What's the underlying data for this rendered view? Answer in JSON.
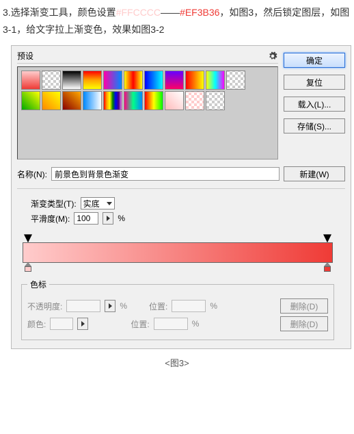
{
  "instructions": {
    "step_number": "3.",
    "text_a": "选择渐变工具，颜色设置",
    "hex1": "#FFCCCC",
    "dash": "——",
    "hex2": "#EF3B36",
    "text_b": "，如图3，然后锁定图层，如图3-1，给文字拉上渐变色，效果如图3-2"
  },
  "presets": {
    "label": "预设"
  },
  "buttons": {
    "ok": "确定",
    "reset": "复位",
    "load": "载入(L)...",
    "save": "存储(S)...",
    "new": "新建(W)"
  },
  "name": {
    "label": "名称(N):",
    "value": "前景色到背景色渐变"
  },
  "gradient": {
    "type_label": "渐变类型(T):",
    "type_value": "实底",
    "smooth_label": "平滑度(M):",
    "smooth_value": "100",
    "smooth_unit": "%",
    "color_start": "#FFCCCC",
    "color_end": "#EF3B36"
  },
  "stops": {
    "legend": "色标",
    "opacity_label": "不透明度:",
    "color_label": "颜色:",
    "position_label": "位置:",
    "percent": "%",
    "delete": "删除(D)"
  },
  "caption": "<图3>"
}
